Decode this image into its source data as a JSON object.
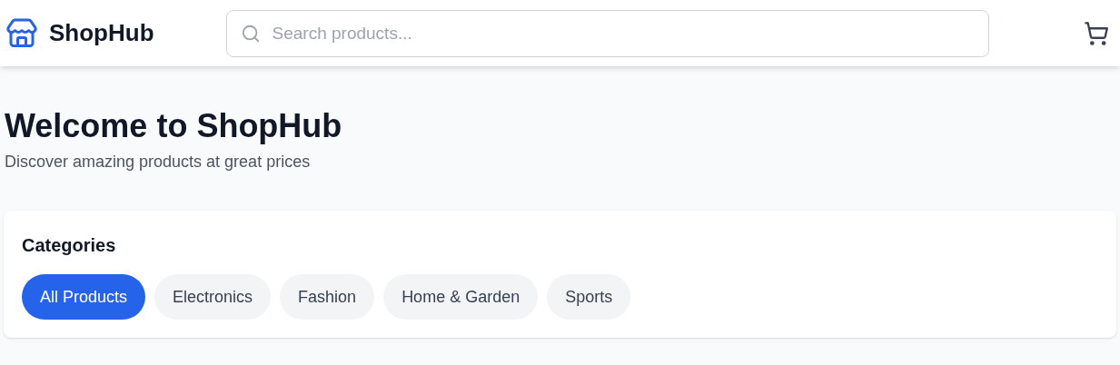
{
  "header": {
    "logo": "ShopHub",
    "search": {
      "placeholder": "Search products..."
    }
  },
  "hero": {
    "title": "Welcome to ShopHub",
    "subtitle": "Discover amazing products at great prices"
  },
  "categories": {
    "title": "Categories",
    "items": [
      {
        "label": "All Products",
        "selected": true
      },
      {
        "label": "Electronics",
        "selected": false
      },
      {
        "label": "Fashion",
        "selected": false
      },
      {
        "label": "Home & Garden",
        "selected": false
      },
      {
        "label": "Sports",
        "selected": false
      }
    ]
  }
}
